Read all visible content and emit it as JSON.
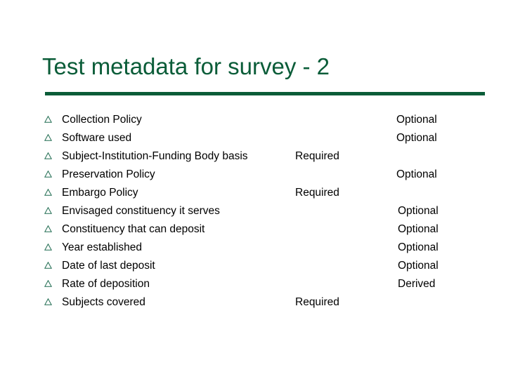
{
  "slide": {
    "title": "Test metadata for survey - 2",
    "title_color": "#0a5c38",
    "rule_color": "#0a5c38",
    "background_color": "#ffffff",
    "bullet_icon": "hollow-triangle-bullet",
    "bullet_color": "#1f6b50",
    "text_color": "#000000"
  },
  "rows": [
    {
      "label": "Collection Policy",
      "status": "Optional",
      "column": "right"
    },
    {
      "label": "Software used",
      "status": "Optional",
      "column": "right"
    },
    {
      "label": "Subject-Institution-Funding Body basis",
      "status": "Required",
      "column": "middle"
    },
    {
      "label": "Preservation Policy",
      "status": "Optional",
      "column": "right"
    },
    {
      "label": "Embargo Policy",
      "status": "Required",
      "column": "middle"
    },
    {
      "label": "Envisaged constituency it serves",
      "status": "Optional",
      "column": "right2"
    },
    {
      "label": "Constituency that can deposit",
      "status": "Optional",
      "column": "right2"
    },
    {
      "label": "Year established",
      "status": "Optional",
      "column": "right2"
    },
    {
      "label": "Date of last deposit",
      "status": "Optional",
      "column": "right2"
    },
    {
      "label": "Rate of deposition",
      "status": "Derived",
      "column": "right2"
    },
    {
      "label": "Subjects covered",
      "status": "Required",
      "column": "middle"
    }
  ]
}
